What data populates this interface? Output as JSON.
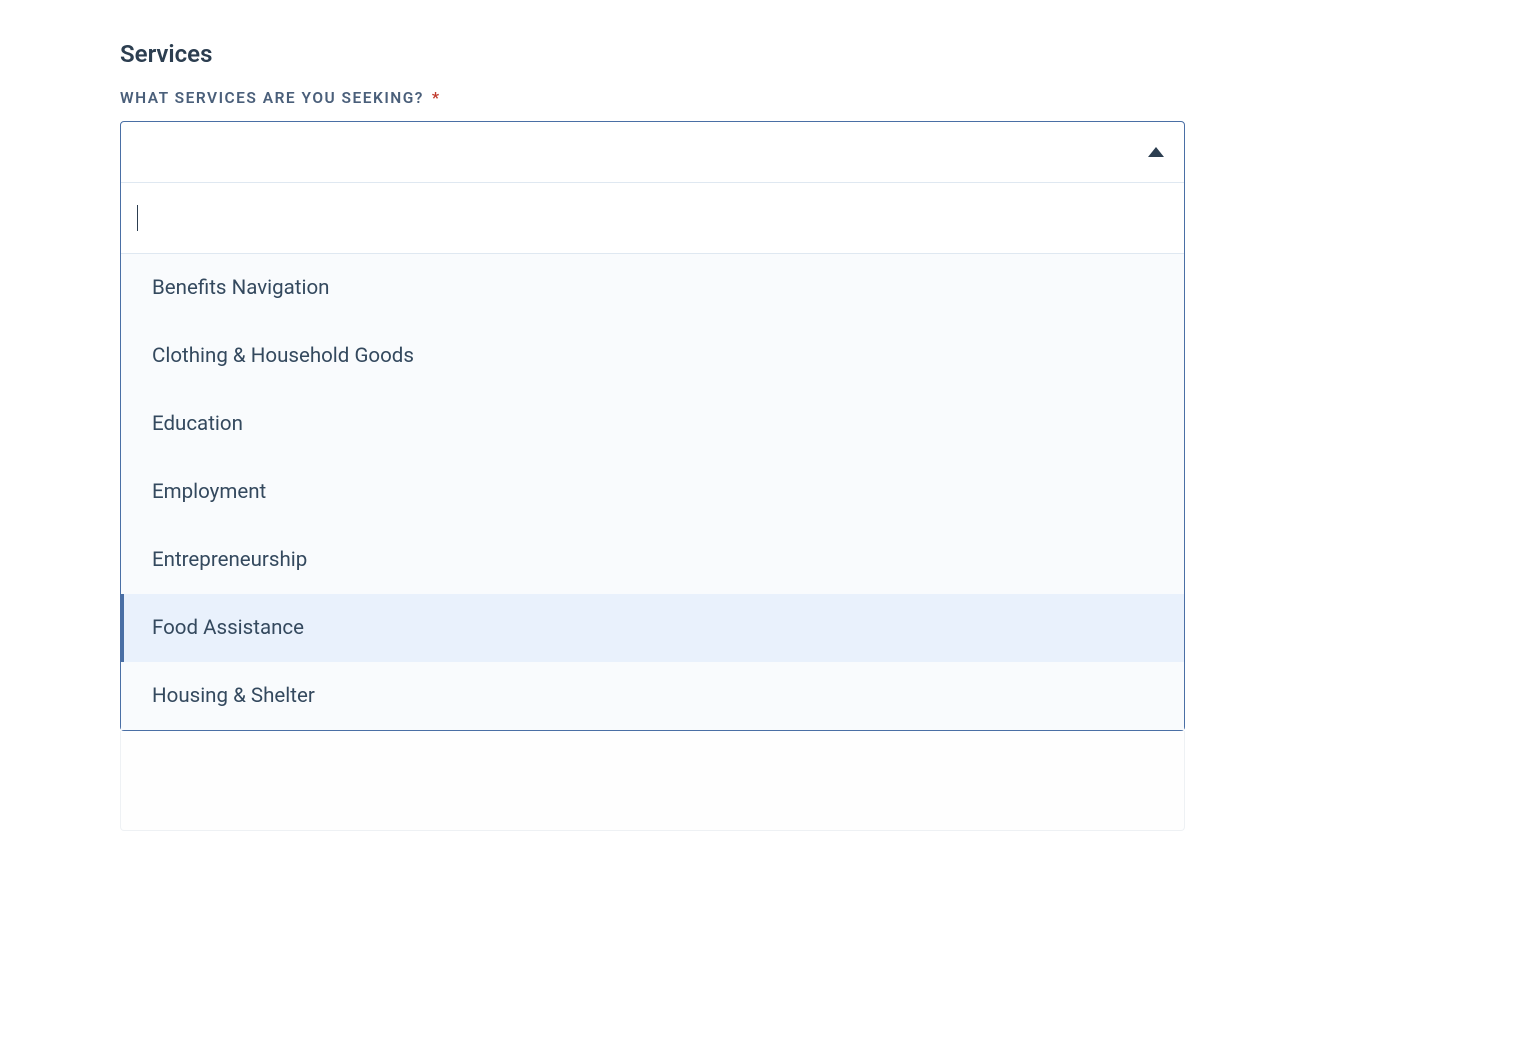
{
  "section": {
    "title": "Services"
  },
  "field": {
    "label": "WHAT SERVICES ARE YOU SEEKING?",
    "required_marker": "*",
    "selected_value": "",
    "search_value": ""
  },
  "options": [
    {
      "label": "Benefits Navigation",
      "highlighted": false
    },
    {
      "label": "Clothing & Household Goods",
      "highlighted": false
    },
    {
      "label": "Education",
      "highlighted": false
    },
    {
      "label": "Employment",
      "highlighted": false
    },
    {
      "label": "Entrepreneurship",
      "highlighted": false
    },
    {
      "label": "Food Assistance",
      "highlighted": true
    },
    {
      "label": "Housing & Shelter",
      "highlighted": false
    }
  ]
}
